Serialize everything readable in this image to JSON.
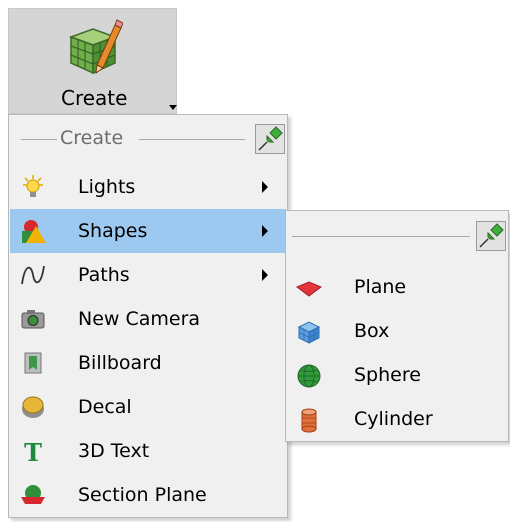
{
  "ribbon_button": {
    "label": "Create",
    "icon": "cube-pencil-icon"
  },
  "menu": {
    "header": "Create",
    "pin_icon": "pin-icon",
    "items": [
      {
        "label": "Lights",
        "icon": "lightbulb-icon",
        "has_submenu": true,
        "selected": false
      },
      {
        "label": "Shapes",
        "icon": "shapes-icon",
        "has_submenu": true,
        "selected": true
      },
      {
        "label": "Paths",
        "icon": "path-curve-icon",
        "has_submenu": true,
        "selected": false
      },
      {
        "label": "New Camera",
        "icon": "camera-icon",
        "has_submenu": false,
        "selected": false
      },
      {
        "label": "Billboard",
        "icon": "billboard-icon",
        "has_submenu": false,
        "selected": false
      },
      {
        "label": "Decal",
        "icon": "decal-icon",
        "has_submenu": false,
        "selected": false
      },
      {
        "label": "3D Text",
        "icon": "text-3d-icon",
        "has_submenu": false,
        "selected": false
      },
      {
        "label": "Section Plane",
        "icon": "section-plane-icon",
        "has_submenu": false,
        "selected": false
      }
    ]
  },
  "submenu": {
    "parent": "Shapes",
    "pin_icon": "pin-icon",
    "items": [
      {
        "label": "Plane",
        "icon": "plane-icon"
      },
      {
        "label": "Box",
        "icon": "box-icon"
      },
      {
        "label": "Sphere",
        "icon": "sphere-icon"
      },
      {
        "label": "Cylinder",
        "icon": "cylinder-icon"
      }
    ]
  },
  "colors": {
    "selection": "#9dc9f0",
    "menu_bg": "#f0f0f0",
    "ribbon_bg": "#d5d5d5",
    "pin_green": "#3fae3a"
  }
}
